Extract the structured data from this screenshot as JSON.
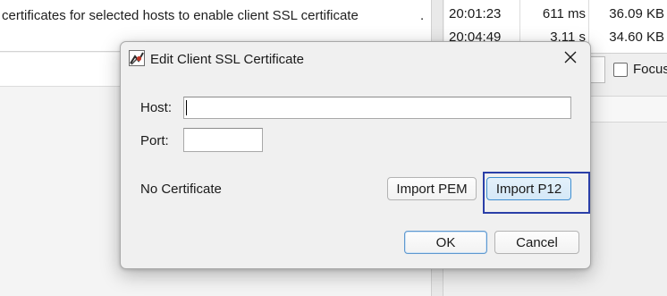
{
  "background": {
    "description_text": "certificates for selected hosts to enable client SSL certificate",
    "description_dot": ".",
    "requests": [
      {
        "time": "20:01:23",
        "duration": "611 ms",
        "size": "36.09 KB"
      },
      {
        "time": "20:04:49",
        "duration": "3.11 s",
        "size": "34.60 KB"
      }
    ],
    "focus_label": "Focus"
  },
  "dialog": {
    "title": "Edit Client SSL Certificate",
    "host_label": "Host:",
    "host_value": "",
    "port_label": "Port:",
    "port_value": "",
    "certificate_status": "No Certificate",
    "import_pem_label": "Import PEM",
    "import_p12_label": "Import P12",
    "ok_label": "OK",
    "cancel_label": "Cancel"
  },
  "icons": {
    "app": "app-logo-icon",
    "close": "close-icon"
  },
  "colors": {
    "focus_ring": "#2b3fa8",
    "default_button_border": "#5e98cf"
  }
}
